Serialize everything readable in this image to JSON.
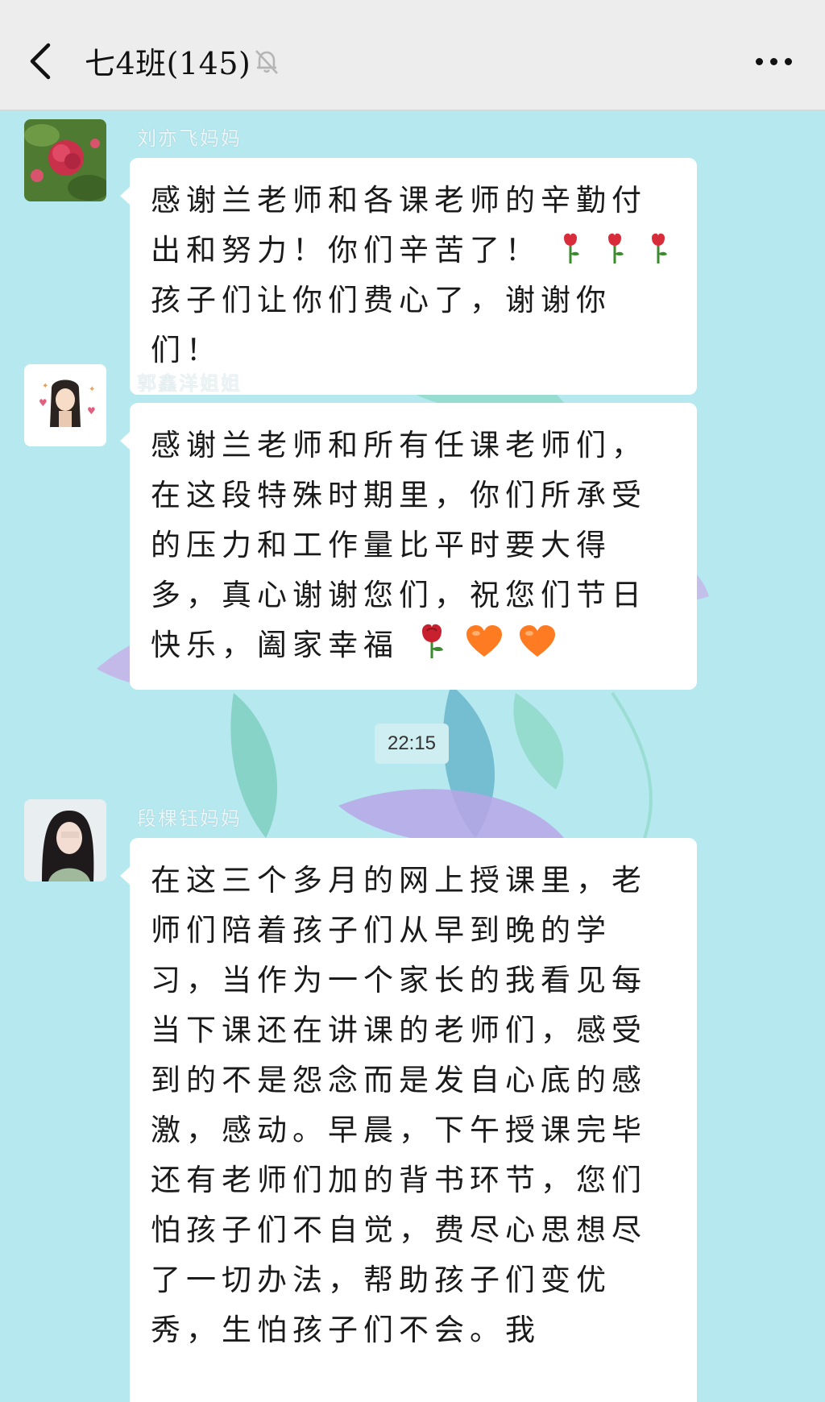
{
  "header": {
    "title": "七4班(145)",
    "icons": {
      "back": "back-chevron-icon",
      "mute": "bell-muted-icon",
      "more": "more-dots-icon"
    }
  },
  "messages": [
    {
      "sender": "刘亦飞妈妈",
      "avatar": "avatar-red-flower",
      "parts": [
        "感谢兰老师和各课老师的辛勤付出和努力！你们辛苦了！",
        "孩子们让你们费心了，谢谢你们！"
      ],
      "emoji": [
        "rose-icon",
        "rose-icon",
        "rose-icon"
      ]
    },
    {
      "sender": "郭鑫洋姐姐",
      "avatar": "avatar-cartoon-girl",
      "parts": [
        "感谢兰老师和所有任课老师们，在这段特殊时期里，你们所承受的压力和工作量比平时要大得多，真心谢谢您们，祝您们节日快乐，阖家幸福"
      ],
      "emoji": [
        "rose-icon",
        "orange-heart-icon",
        "orange-heart-icon"
      ]
    },
    {
      "sender": "段棵钰妈妈",
      "avatar": "avatar-girl-photo",
      "parts": [
        "在这三个多月的网上授课里，老师们陪着孩子们从早到晚的学习，当作为一个家长的我看见每当下课还在讲课的老师们，感受到的不是怨念而是发自心底的感激，感动。早晨，下午授课完毕还有老师们加的背书环节，您们怕孩子们不自觉，费尽心思想尽了一切办法，帮助孩子们变优秀，生怕孩子们不会。我"
      ]
    }
  ],
  "timestamp": "22:15",
  "colors": {
    "chat_bg": "#b5e8ef",
    "header_bg": "#ededed",
    "bubble": "#ffffff"
  }
}
